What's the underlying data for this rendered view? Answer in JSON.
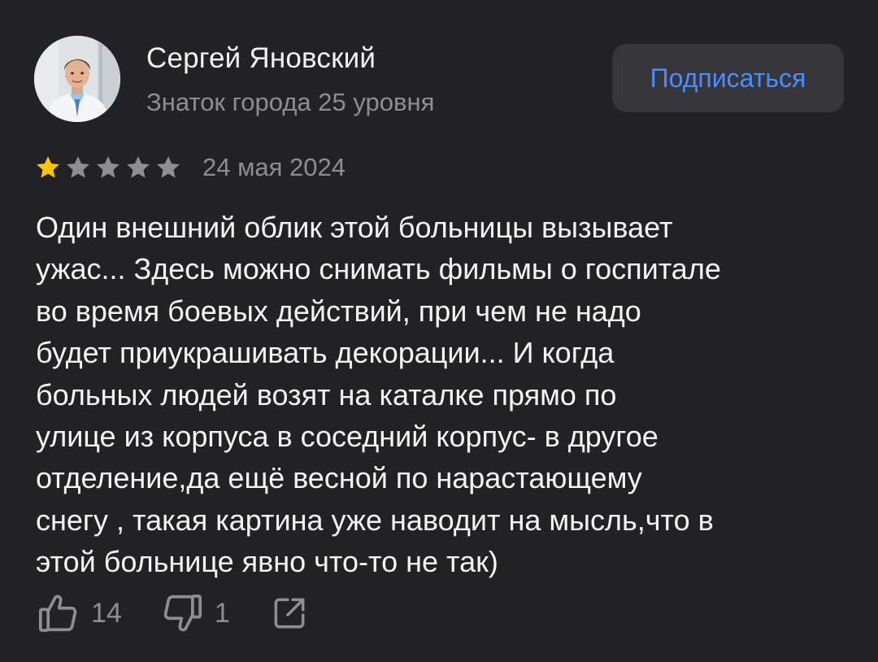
{
  "author": {
    "name": "Сергей Яновский",
    "level": "Знаток города 25 уровня",
    "avatar_icon": "user-photo"
  },
  "subscribe_button": {
    "label": "Подписаться",
    "color": "#4b8dff"
  },
  "review": {
    "rating": 1,
    "max_rating": 5,
    "date": "24 мая 2024",
    "text_lines": [
      "Один внешний облик этой больницы вызывает",
      "ужас... Здесь можно снимать фильмы о госпитале",
      "во время боевых действий, при чем не надо",
      "будет приукрашивать декорации... И когда",
      "больных людей возят на каталке прямо по",
      "улице из корпуса в соседний корпус- в другое",
      "отделение,да ещё весной по нарастающему",
      "снегу , такая картина уже наводит на мысль,что в",
      "этой больнице явно что-то не так)"
    ]
  },
  "actions": {
    "likes": "14",
    "dislikes": "1",
    "like_icon": "thumbs-up-icon",
    "dislike_icon": "thumbs-down-icon",
    "share_icon": "share-icon"
  },
  "colors": {
    "background": "#222224",
    "star_filled": "#fcc400",
    "star_empty": "#8d8d93",
    "secondary_text": "#8d8d93"
  }
}
